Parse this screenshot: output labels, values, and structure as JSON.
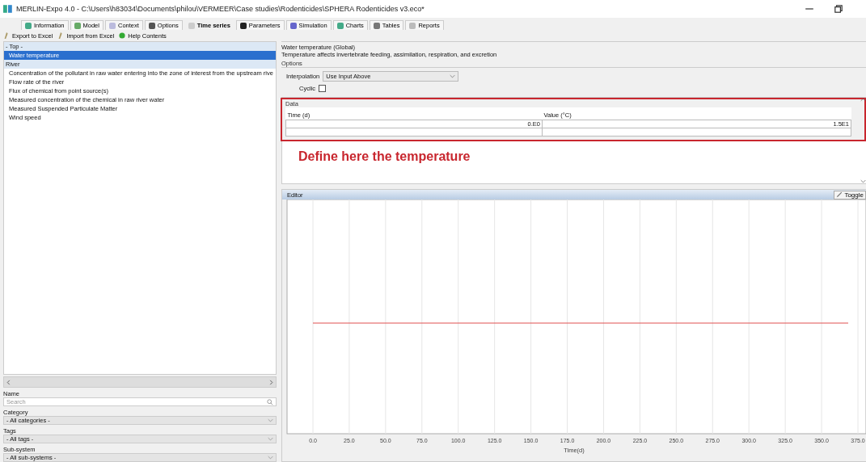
{
  "window": {
    "title": "MERLIN-Expo 4.0 - C:\\Users\\h83034\\Documents\\philou\\VERMEER\\Case studies\\Rodenticides\\SPHERA Rodenticides v3.eco*"
  },
  "tabs": [
    {
      "label": "Information",
      "selected": false
    },
    {
      "label": "Model",
      "selected": false
    },
    {
      "label": "Context",
      "selected": false
    },
    {
      "label": "Options",
      "selected": false
    },
    {
      "label": "Time series",
      "selected": true
    },
    {
      "label": "Parameters",
      "selected": false
    },
    {
      "label": "Simulation",
      "selected": false
    },
    {
      "label": "Charts",
      "selected": false
    },
    {
      "label": "Tables",
      "selected": false
    },
    {
      "label": "Reports",
      "selected": false
    }
  ],
  "toolbar": [
    {
      "label": "Export to Excel"
    },
    {
      "label": "Import from Excel"
    },
    {
      "label": "Help Contents"
    }
  ],
  "tree": [
    {
      "label": "- Top -",
      "children": [
        {
          "label": "Water temperature",
          "selected": true
        }
      ]
    },
    {
      "label": "River",
      "children": [
        {
          "label": "Concentration of the pollutant in raw water entering into the zone of interest from the upstream rive",
          "selected": false
        },
        {
          "label": "Flow rate of the river",
          "selected": false
        },
        {
          "label": "Flux of chemical from point source(s)",
          "selected": false
        },
        {
          "label": "Measured concentration of the chemical in raw river water",
          "selected": false
        },
        {
          "label": "Measured Suspended Particulate Matter",
          "selected": false
        },
        {
          "label": "Wind speed",
          "selected": false
        }
      ]
    }
  ],
  "filters": [
    {
      "kind": "search",
      "label": "Name",
      "placeholder": "Search"
    },
    {
      "kind": "select",
      "label": "Category",
      "value": "- All categories -"
    },
    {
      "kind": "select",
      "label": "Tags",
      "value": "- All tags -"
    },
    {
      "kind": "select",
      "label": "Sub-system",
      "value": "- All sub-systems -"
    }
  ],
  "detail": {
    "title": "Water temperature (Global)",
    "description": "Temperature affects invertebrate feeding, assimilation, respiration, and excretion",
    "options_label": "Options",
    "interpolation_label": "Interpolation",
    "interpolation": "Use Input Above",
    "cyclic_label": "Cyclic",
    "cyclic": false,
    "data_label": "Data",
    "columns": [
      "Time (d)",
      "Value (°C)"
    ],
    "rows": [
      [
        "0.E0",
        "1.5E1"
      ]
    ],
    "annotation": "Define here the temperature"
  },
  "editor": {
    "title": "Editor",
    "toggle": "Toggle",
    "chart": {
      "xlabel": "Time(d)",
      "xticks": [
        "0.0",
        "25.0",
        "50.0",
        "75.0",
        "100.0",
        "125.0",
        "150.0",
        "175.0",
        "200.0",
        "225.0",
        "250.0",
        "275.0",
        "300.0",
        "325.0",
        "350.0",
        "375.0"
      ]
    }
  }
}
